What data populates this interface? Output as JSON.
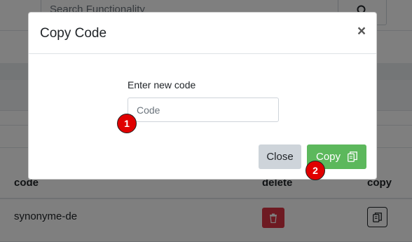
{
  "background": {
    "search_placeholder": "Search Functionality",
    "table": {
      "headers": [
        "code",
        "delete",
        "copy"
      ],
      "rows": [
        {
          "code": "synonyme-de"
        }
      ]
    }
  },
  "modal": {
    "title": "Copy Code",
    "close_glyph": "×",
    "field_label": "Enter new code",
    "input_placeholder": "Code",
    "input_value": "",
    "close_button_label": "Close",
    "copy_button_label": "Copy"
  },
  "markers": [
    "1",
    "2"
  ],
  "colors": {
    "overlay": "rgba(0,0,0,0.5)",
    "copy_button": "#5cb85c",
    "close_button": "#ced4da",
    "delete_button": "#dc3545",
    "marker": "#e00000"
  },
  "icons": {
    "search": "search-icon",
    "trash": "trash-icon",
    "copy": "copy-icon"
  }
}
